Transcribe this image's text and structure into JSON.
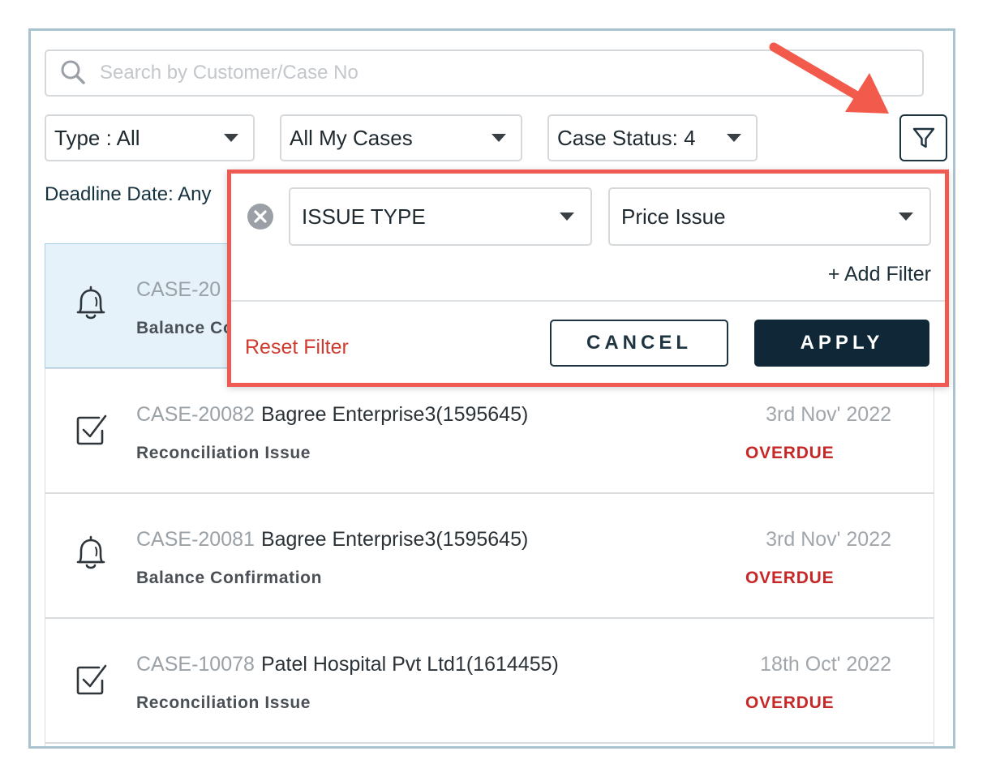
{
  "search": {
    "placeholder": "Search by Customer/Case No",
    "value": ""
  },
  "filters": {
    "type_label": "Type : All",
    "cases_label": "All My Cases",
    "status_label": "Case Status: 4"
  },
  "deadline_label": "Deadline Date: Any",
  "cases": [
    {
      "case_no": "CASE-20",
      "name": "",
      "type": "Balance Co",
      "date": "",
      "status": "",
      "icon": "bell-icon"
    },
    {
      "case_no": "CASE-20082",
      "name": "Bagree Enterprise3(1595645)",
      "type": "Reconciliation Issue",
      "date": "3rd Nov' 2022",
      "status": "OVERDUE",
      "icon": "checkbox-icon"
    },
    {
      "case_no": "CASE-20081",
      "name": "Bagree Enterprise3(1595645)",
      "type": "Balance Confirmation",
      "date": "3rd Nov' 2022",
      "status": "OVERDUE",
      "icon": "bell-icon"
    },
    {
      "case_no": "CASE-10078",
      "name": "Patel Hospital Pvt Ltd1(1614455)",
      "type": "Reconciliation Issue",
      "date": "18th Oct' 2022",
      "status": "OVERDUE",
      "icon": "checkbox-icon"
    }
  ],
  "filter_popup": {
    "field_label": "ISSUE TYPE",
    "value_label": "Price Issue",
    "add_filter": "+ Add Filter",
    "reset_filter": "Reset Filter",
    "cancel": "CANCEL",
    "apply": "APPLY"
  },
  "colors": {
    "accent_dark": "#0f2736",
    "overdue": "#c62828",
    "highlight_border": "#ef5a52",
    "active_row": "#e6f2fa"
  }
}
